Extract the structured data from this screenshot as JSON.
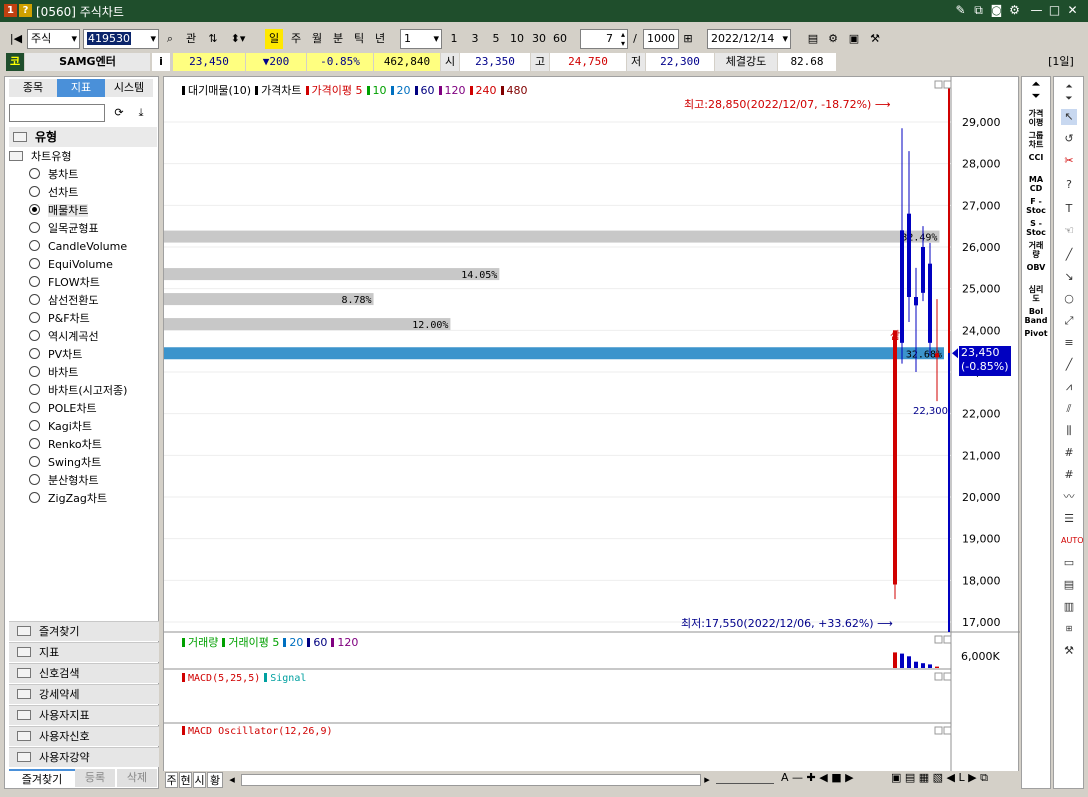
{
  "window": {
    "title": "[0560] 주식차트",
    "icon1": "1",
    "icon2": "?"
  },
  "toolbar": {
    "market": "주식",
    "code": "419530",
    "lookup": "관",
    "period_active": "일",
    "periods": [
      "주",
      "월",
      "분",
      "틱",
      "년"
    ],
    "unit_value": "1",
    "min_buttons": [
      "1",
      "3",
      "5",
      "10",
      "30",
      "60"
    ],
    "count": "7",
    "slash": "/",
    "total": "1000",
    "date": "2022/12/14"
  },
  "info": {
    "market_badge": "코",
    "name": "SAMG엔터",
    "i": "i",
    "price": "23,450",
    "change": "▼200",
    "rate": "-0.85%",
    "volume": "462,840",
    "open_label": "시",
    "open": "23,350",
    "high_label": "고",
    "high": "24,750",
    "low_label": "저",
    "low": "22,300",
    "strength_label": "체결강도",
    "strength": "82.68",
    "period_badge": "[1일]"
  },
  "left": {
    "tabs": [
      "종목",
      "지표",
      "시스템"
    ],
    "active_tab": "지표",
    "category": "유형",
    "tree_root": "차트유형",
    "chart_types": [
      "봉차트",
      "선차트",
      "매물차트",
      "일목균형표",
      "CandleVolume",
      "EquiVolume",
      "FLOW차트",
      "삼선전환도",
      "P&F차트",
      "역시계곡선",
      "PV차트",
      "바차트",
      "바차트(시고저종)",
      "POLE차트",
      "Kagi차트",
      "Renko차트",
      "Swing차트",
      "분산형차트",
      "ZigZag차트"
    ],
    "selected_type": "매물차트",
    "sections": [
      "즐겨찾기",
      "지표",
      "신호검색",
      "강세약세",
      "사용자지표",
      "사용자신호",
      "사용자강약"
    ],
    "bottom_tabs": [
      "즐겨찾기",
      "등록",
      "삭제"
    ]
  },
  "price_pane": {
    "legend": [
      {
        "text": "대기매물(10)",
        "color": "#000000"
      },
      {
        "text": "가격차트",
        "color": "#000000"
      },
      {
        "text": "가격이평 5",
        "color": "#d00000"
      },
      {
        "text": "10",
        "color": "#00a000"
      },
      {
        "text": "20",
        "color": "#0070c0"
      },
      {
        "text": "60",
        "color": "#000080"
      },
      {
        "text": "120",
        "color": "#800080"
      },
      {
        "text": "240",
        "color": "#d00000"
      },
      {
        "text": "480",
        "color": "#800000"
      }
    ],
    "high_note": "최고:28,850(2022/12/07, -18.72%)",
    "low_note": "최저:17,550(2022/12/06, +33.62%)",
    "low_value_label": "22,300",
    "current_badge_price": "23,450",
    "current_badge_rate": "(-0.85%)",
    "signal_label": "삼"
  },
  "volume_pane": {
    "legend": [
      {
        "text": "거래량",
        "color": "#00a000"
      },
      {
        "text": "거래이평 5",
        "color": "#00a000"
      },
      {
        "text": "20",
        "color": "#0070c0"
      },
      {
        "text": "60",
        "color": "#000080"
      },
      {
        "text": "120",
        "color": "#800080"
      }
    ],
    "axis_label": "6,000K"
  },
  "macd_pane": {
    "legend": [
      {
        "text": "MACD(5,25,5)",
        "color": "#d00000"
      },
      {
        "text": "Signal",
        "color": "#00a0a0"
      }
    ]
  },
  "osc_pane": {
    "legend": [
      {
        "text": "MACD Oscillator(12,26,9)",
        "color": "#d00000"
      }
    ]
  },
  "bottom": {
    "tabs": [
      "주",
      "현",
      "시",
      "황"
    ]
  },
  "right_tools": [
    "가격\n이평",
    "그룹\n차트",
    "CCI",
    "MA\nCD",
    "F -\nStoc",
    "S -\nStoc",
    "거래\n량",
    "OBV",
    "심리\n도",
    "Bol\nBand",
    "Pivot"
  ],
  "colors": {
    "up": "#d00000",
    "down": "#0000c0",
    "accent": "#1f4e2c",
    "current_bar": "#3c94cc"
  },
  "chart_data": {
    "type": "candlestick",
    "y_ticks": [
      "29,000",
      "28,000",
      "27,000",
      "26,000",
      "25,000",
      "24,000",
      "23,000",
      "22,000",
      "21,000",
      "20,000",
      "19,000",
      "18,000",
      "17,000"
    ],
    "ylim": [
      17000,
      29300
    ],
    "candles": [
      {
        "open": 17900,
        "high": 24000,
        "low": 17550,
        "close": 24000
      },
      {
        "open": 26400,
        "high": 28850,
        "low": 23200,
        "close": 23700
      },
      {
        "open": 26800,
        "high": 28300,
        "low": 24200,
        "close": 24800
      },
      {
        "open": 24800,
        "high": 25500,
        "low": 23000,
        "close": 24600
      },
      {
        "open": 26000,
        "high": 26500,
        "low": 24700,
        "close": 24900
      },
      {
        "open": 25600,
        "high": 26100,
        "low": 23400,
        "close": 23700
      },
      {
        "open": 23350,
        "high": 24750,
        "low": 22300,
        "close": 23450
      }
    ],
    "volume_profile": [
      {
        "price": 26250,
        "pct": "32.49%",
        "ratio": 32.49
      },
      {
        "price": 25350,
        "pct": "14.05%",
        "ratio": 14.05
      },
      {
        "price": 24750,
        "pct": "8.78%",
        "ratio": 8.78
      },
      {
        "price": 24150,
        "pct": "12.00%",
        "ratio": 12.0
      },
      {
        "price": 23450,
        "pct": "32.68%",
        "ratio": 32.68
      }
    ],
    "volume": [
      5200,
      4800,
      3900,
      2100,
      1600,
      1200,
      462
    ]
  }
}
